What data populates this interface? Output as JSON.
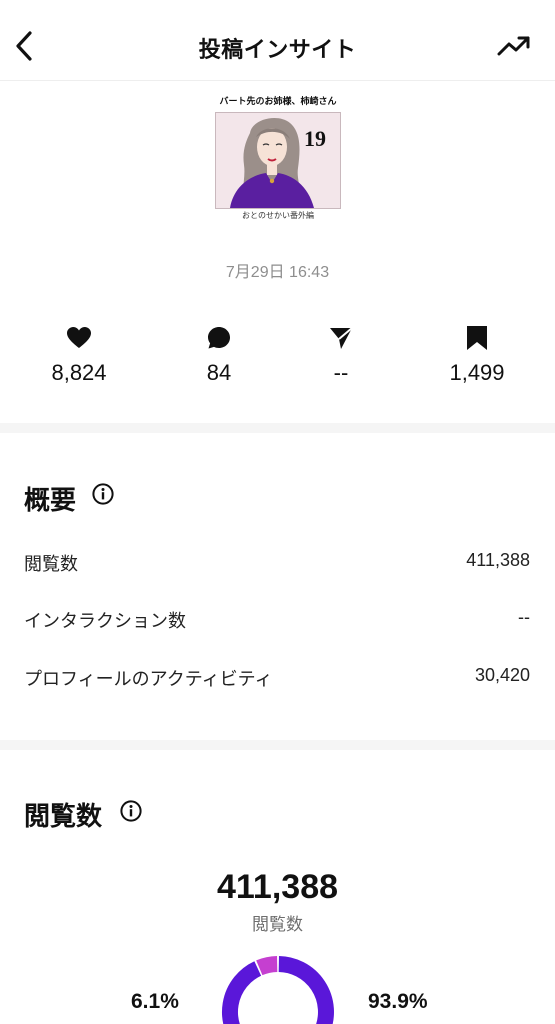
{
  "header": {
    "title": "投稿インサイト",
    "back_icon": "chevron-left-icon",
    "trend_icon": "trend-up-icon"
  },
  "post": {
    "caption_top": "バート先のお姉様、柿崎さん",
    "episode_number": "19",
    "caption_bottom": "おとのせかい番外編",
    "date": "7月29日 16:43"
  },
  "stats": [
    {
      "icon": "heart-icon",
      "value": "8,824"
    },
    {
      "icon": "comment-icon",
      "value": "84"
    },
    {
      "icon": "send-icon",
      "value": "--"
    },
    {
      "icon": "bookmark-icon",
      "value": "1,499"
    }
  ],
  "overview": {
    "title": "概要",
    "rows": [
      {
        "label": "閲覧数",
        "value": "411,388"
      },
      {
        "label": "インタラクション数",
        "value": "--"
      },
      {
        "label": "プロフィールのアクティビティ",
        "value": "30,420"
      }
    ]
  },
  "views": {
    "title": "閲覧数",
    "total": "411,388",
    "total_label": "閲覧数",
    "left_pct": "6.1%",
    "right_pct": "93.9%",
    "left_fraction": 0.061,
    "right_fraction": 0.939,
    "colors": {
      "primary": "#5a17d9",
      "secondary": "#c53fd0"
    }
  }
}
